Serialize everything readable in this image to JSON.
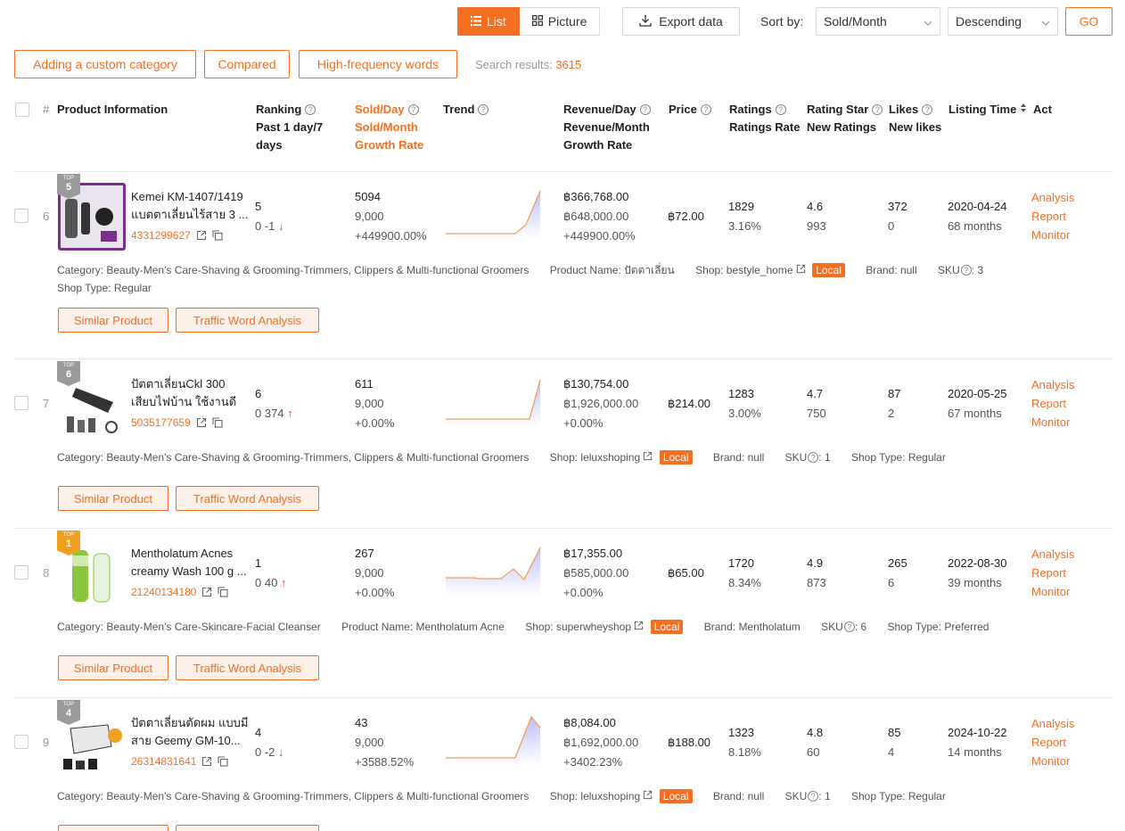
{
  "toolbar": {
    "list_label": "List",
    "picture_label": "Picture",
    "export_label": "Export data",
    "sort_label": "Sort by:",
    "sort_value": "Sold/Month",
    "order_value": "Descending",
    "go_label": "GO"
  },
  "filters": {
    "custom_category": "Adding a custom category",
    "compared": "Compared",
    "high_freq": "High-frequency words",
    "search_results_label": "Search results:",
    "search_results_count": "3615"
  },
  "columns": {
    "hash": "#",
    "product_info": "Product Information",
    "ranking_1": "Ranking",
    "ranking_2": "Past 1 day/7",
    "ranking_3": "days",
    "sold_1": "Sold/Day",
    "sold_2": "Sold/Month",
    "sold_3": "Growth Rate",
    "trend": "Trend",
    "rev_1": "Revenue/Day",
    "rev_2": "Revenue/Month",
    "rev_3": "Growth Rate",
    "price": "Price",
    "ratings_1": "Ratings",
    "ratings_2": "Ratings Rate",
    "star_1": "Rating Star",
    "star_2": "New Ratings",
    "likes_1": "Likes",
    "likes_2": "New likes",
    "listing": "Listing Time",
    "act": "Act"
  },
  "rows": [
    {
      "num": "6",
      "badge": "5",
      "badge_top": "TOP",
      "name": "Kemei KM-1407/1419 แบตตาเลี่ยนไร้สาย 3 ...",
      "id": "4331299627",
      "rank": "5",
      "rank_sub": "0 -1",
      "sold_day": "5094",
      "sold_month": "9,000",
      "sold_growth": "+449900.00%",
      "rev_day": "฿366,768.00",
      "rev_month": "฿648,000.00",
      "rev_growth": "+449900.00%",
      "price": "฿72.00",
      "ratings": "1829",
      "ratings_rate": "3.16%",
      "star": "4.6",
      "new_ratings": "993",
      "likes": "372",
      "new_likes": "0",
      "listing": "2020-04-24",
      "listing_age": "68 months",
      "category": "Beauty-Men's Care-Shaving & Grooming-Trimmers, Clippers & Multi-functional Groomers",
      "product_name": "ปัตตาเลี่ยน",
      "shop": "bestyle_home",
      "brand": "null",
      "sku": "3",
      "shop_type": "Regular"
    },
    {
      "num": "7",
      "badge": "6",
      "badge_top": "TOP",
      "name": "ปัตตาเลี่ยนCkl 300 เสียบไฟบ้าน ใช้งานดี",
      "id": "5035177659",
      "rank": "6",
      "rank_sub": "0 374",
      "sold_day": "611",
      "sold_month": "9,000",
      "sold_growth": "+0.00%",
      "rev_day": "฿130,754.00",
      "rev_month": "฿1,926,000.00",
      "rev_growth": "+0.00%",
      "price": "฿214.00",
      "ratings": "1283",
      "ratings_rate": "3.00%",
      "star": "4.7",
      "new_ratings": "750",
      "likes": "87",
      "new_likes": "2",
      "listing": "2020-05-25",
      "listing_age": "67 months",
      "category": "Beauty-Men's Care-Shaving & Grooming-Trimmers, Clippers & Multi-functional Groomers",
      "shop": "leluxshoping",
      "brand": "null",
      "sku": "1",
      "shop_type": "Regular"
    },
    {
      "num": "8",
      "badge": "1",
      "badge_top": "TOP",
      "name": "Mentholatum Acnes creamy Wash 100 g ...",
      "id": "21240134180",
      "rank": "1",
      "rank_sub": "0 40",
      "sold_day": "267",
      "sold_month": "9,000",
      "sold_growth": "+0.00%",
      "rev_day": "฿17,355.00",
      "rev_month": "฿585,000.00",
      "rev_growth": "+0.00%",
      "price": "฿65.00",
      "ratings": "1720",
      "ratings_rate": "8.34%",
      "star": "4.9",
      "new_ratings": "873",
      "likes": "265",
      "new_likes": "6",
      "listing": "2022-08-30",
      "listing_age": "39 months",
      "category": "Beauty-Men's Care-Skincare-Facial Cleanser",
      "product_name": "Mentholatum Acne",
      "shop": "superwheyshop",
      "brand": "Mentholatum",
      "sku": "6",
      "shop_type": "Preferred"
    },
    {
      "num": "9",
      "badge": "4",
      "badge_top": "TOP",
      "name": "ปัตตาเลี่ยนตัดผม แบบมีสาย Geemy GM-10...",
      "id": "26314831641",
      "rank": "4",
      "rank_sub": "0 -2",
      "sold_day": "43",
      "sold_month": "9,000",
      "sold_growth": "+3588.52%",
      "rev_day": "฿8,084.00",
      "rev_month": "฿1,692,000.00",
      "rev_growth": "+3402.23%",
      "price": "฿188.00",
      "ratings": "1323",
      "ratings_rate": "8.18%",
      "star": "4.8",
      "new_ratings": "60",
      "likes": "85",
      "new_likes": "4",
      "listing": "2024-10-22",
      "listing_age": "14 months",
      "category": "Beauty-Men's Care-Shaving & Grooming-Trimmers, Clippers & Multi-functional Groomers",
      "shop": "leluxshoping",
      "brand": "null",
      "sku": "1",
      "shop_type": "Regular"
    }
  ],
  "labels": {
    "category": "Category:",
    "product_name": "Product Name:",
    "shop": "Shop:",
    "brand": "Brand:",
    "sku": "SKU",
    "shop_type": "Shop Type:",
    "local": "Local",
    "similar": "Similar Product",
    "traffic": "Traffic Word Analysis",
    "analysis": "Analysis",
    "report": "Report",
    "monitor": "Monitor"
  },
  "colors": {
    "accent": "#f46f22",
    "up": "#e8453c",
    "down": "#2aa35a"
  }
}
